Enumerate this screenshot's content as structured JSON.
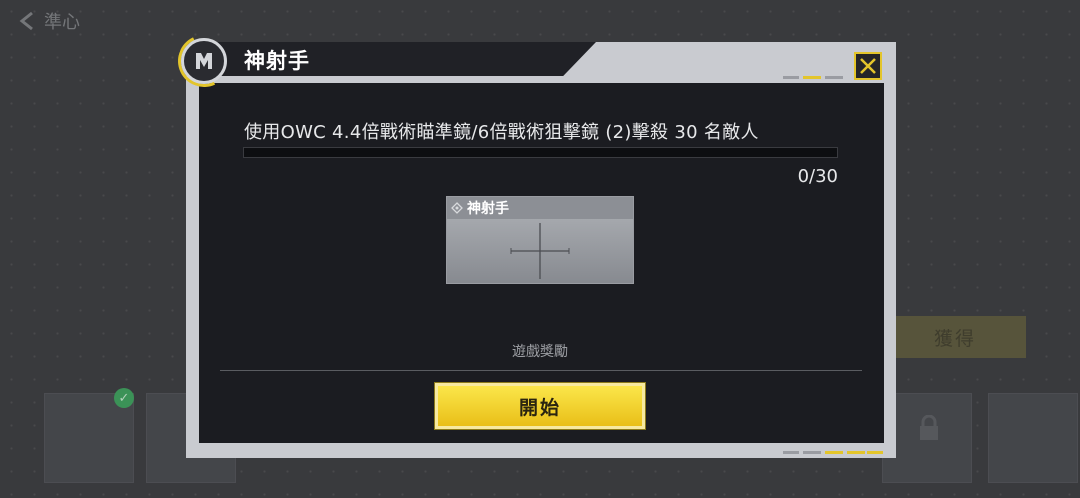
{
  "background": {
    "back_label": "準心",
    "obtain_label": "獲得"
  },
  "modal": {
    "title": "神射手",
    "task_text": "使用OWC 4.4倍戰術瞄準鏡/6倍戰術狙擊鏡 (2)擊殺 30 名敵人",
    "progress": {
      "current": 0,
      "total": 30,
      "label": "0/30"
    },
    "reward_card": {
      "name": "神射手",
      "icon": "crosshair-icon"
    },
    "reward_section_label": "遊戲獎勵",
    "start_button": "開始",
    "close_icon": "close-icon"
  },
  "colors": {
    "accent": "#e3c52b",
    "panel": "#1b1c21",
    "frame": "#c9cbd0"
  }
}
